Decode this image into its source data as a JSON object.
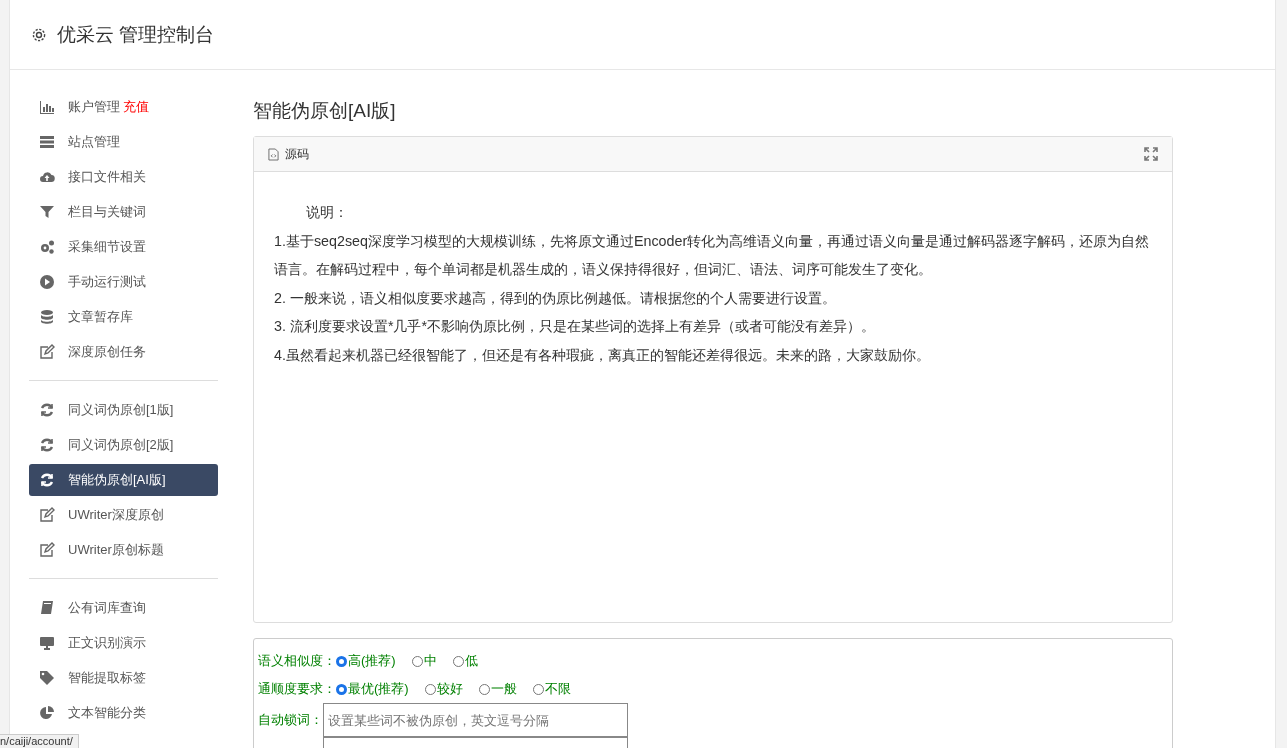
{
  "header": {
    "title": "优采云 管理控制台"
  },
  "sidebar": {
    "groups": [
      {
        "items": [
          {
            "label": "账户管理",
            "badge": "充值",
            "selected": false
          },
          {
            "label": "站点管理",
            "selected": false
          },
          {
            "label": "接口文件相关",
            "selected": false
          },
          {
            "label": "栏目与关键词",
            "selected": false
          },
          {
            "label": "采集细节设置",
            "selected": false
          },
          {
            "label": "手动运行测试",
            "selected": false
          },
          {
            "label": "文章暂存库",
            "selected": false
          },
          {
            "label": "深度原创任务",
            "selected": false
          }
        ]
      },
      {
        "items": [
          {
            "label": "同义词伪原创[1版]",
            "selected": false
          },
          {
            "label": "同义词伪原创[2版]",
            "selected": false
          },
          {
            "label": "智能伪原创[AI版]",
            "selected": true
          },
          {
            "label": "UWriter深度原创",
            "selected": false
          },
          {
            "label": "UWriter原创标题",
            "selected": false
          }
        ]
      },
      {
        "items": [
          {
            "label": "公有词库查询",
            "selected": false
          },
          {
            "label": "正文识别演示",
            "selected": false
          },
          {
            "label": "智能提取标签",
            "selected": false
          },
          {
            "label": "文本智能分类",
            "selected": false
          }
        ]
      }
    ]
  },
  "main": {
    "title": "智能伪原创[AI版]",
    "editor": {
      "tab": "源码",
      "lines": [
        "说明：",
        "1.基于seq2seq深度学习模型的大规模训练，先将原文通过Encoder转化为高维语义向量，再通过语义向量是通过解码器逐字解码，还原为自然语言。在解码过程中，每个单词都是机器生成的，语义保持得很好，但词汇、语法、词序可能发生了变化。",
        "2. 一般来说，语义相似度要求越高，得到的伪原比例越低。请根据您的个人需要进行设置。",
        "3. 流利度要求设置*几乎*不影响伪原比例，只是在某些词的选择上有差异（或者可能没有差异）。",
        "4.虽然看起来机器已经很智能了，但还是有各种瑕疵，离真正的智能还差得很远。未来的路，大家鼓励你。"
      ]
    },
    "options": [
      {
        "label": "语义相似度：",
        "choices": [
          {
            "label": "高(推荐)",
            "selected": true
          },
          {
            "label": "中",
            "selected": false
          },
          {
            "label": "低",
            "selected": false
          }
        ]
      },
      {
        "label": "通顺度要求：",
        "choices": [
          {
            "label": "最优(推荐)",
            "selected": true
          },
          {
            "label": "较好",
            "selected": false
          },
          {
            "label": "一般",
            "selected": false
          },
          {
            "label": "不限",
            "selected": false
          }
        ]
      }
    ],
    "lock_words": {
      "label": "自动锁词：",
      "placeholder": "设置某些词不被伪原创，英文逗号分隔"
    }
  },
  "status_url": "n/caiji/account/"
}
